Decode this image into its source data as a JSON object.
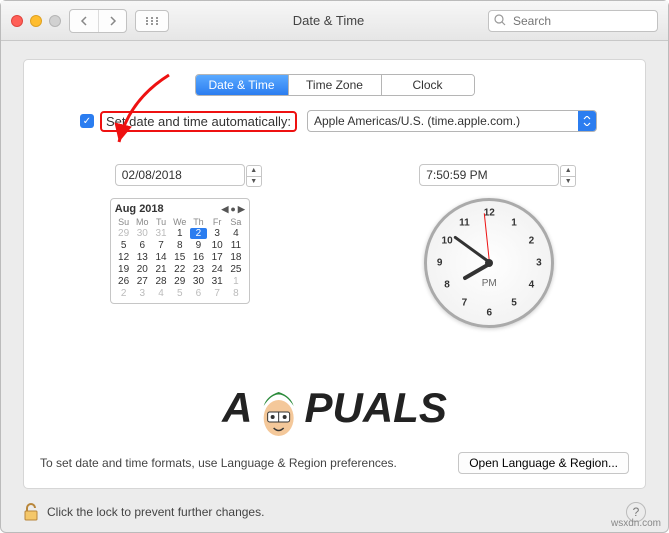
{
  "window": {
    "title": "Date & Time",
    "search_placeholder": "Search"
  },
  "tabs": {
    "items": [
      "Date & Time",
      "Time Zone",
      "Clock"
    ],
    "active": 0
  },
  "auto": {
    "label": "Set date and time automatically:",
    "server": "Apple Americas/U.S. (time.apple.com.)"
  },
  "date": {
    "value": "02/08/2018",
    "month_label": "Aug 2018",
    "dow": [
      "Su",
      "Mo",
      "Tu",
      "We",
      "Th",
      "Fr",
      "Sa"
    ],
    "leading_muted": [
      "29",
      "30",
      "31"
    ],
    "days": [
      "1",
      "2",
      "3",
      "4",
      "5",
      "6",
      "7",
      "8",
      "9",
      "10",
      "11",
      "12",
      "13",
      "14",
      "15",
      "16",
      "17",
      "18",
      "19",
      "20",
      "21",
      "22",
      "23",
      "24",
      "25",
      "26",
      "27",
      "28",
      "29",
      "30",
      "31"
    ],
    "trailing_muted": [
      "1",
      "2",
      "3",
      "4",
      "5",
      "6",
      "7",
      "8"
    ],
    "selected": "2"
  },
  "time": {
    "value": "7:50:59 PM",
    "ampm": "PM",
    "clock_numbers": {
      "12": "12",
      "1": "1",
      "2": "2",
      "3": "3",
      "4": "4",
      "5": "5",
      "6": "6",
      "7": "7",
      "8": "8",
      "9": "9",
      "10": "10",
      "11": "11"
    }
  },
  "footer": {
    "hint": "To set date and time formats, use Language & Region preferences.",
    "open_button": "Open Language & Region..."
  },
  "lock": {
    "text": "Click the lock to prevent further changes."
  },
  "watermark": {
    "pre": "A",
    "post": "PUALS"
  },
  "credit": "wsxdn.com"
}
